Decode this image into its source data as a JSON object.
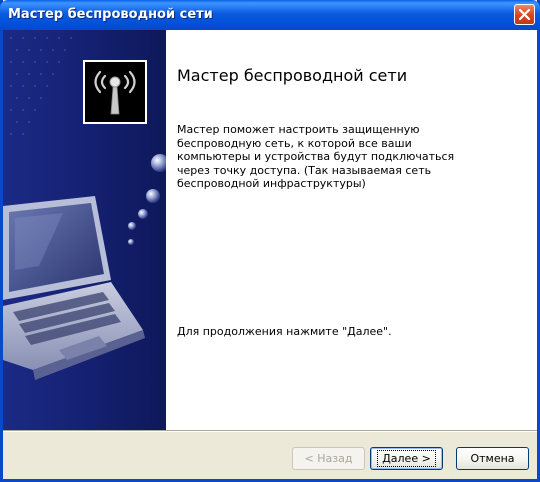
{
  "window": {
    "title": "Мастер беспроводной сети"
  },
  "main": {
    "heading": "Мастер беспроводной сети",
    "description": "Мастер поможет настроить защищенную беспроводную сеть, к которой все ваши компьютеры и устройства будут подключаться через точку доступа. (Так называемая сеть беспроводной инфраструктуры)",
    "continue_hint": "Для продолжения нажмите \"Далее\"."
  },
  "buttons": {
    "back": "< Назад",
    "next": "Далее >",
    "cancel": "Отмена"
  },
  "icons": {
    "wizard": "wireless-antenna-icon",
    "close": "close-icon",
    "side_art": "laptop-icon"
  },
  "colors": {
    "titlebar": "#0a5be0",
    "side_panel": "#142070",
    "close_button": "#d8441f",
    "dialog_bg": "#ece9d8"
  }
}
